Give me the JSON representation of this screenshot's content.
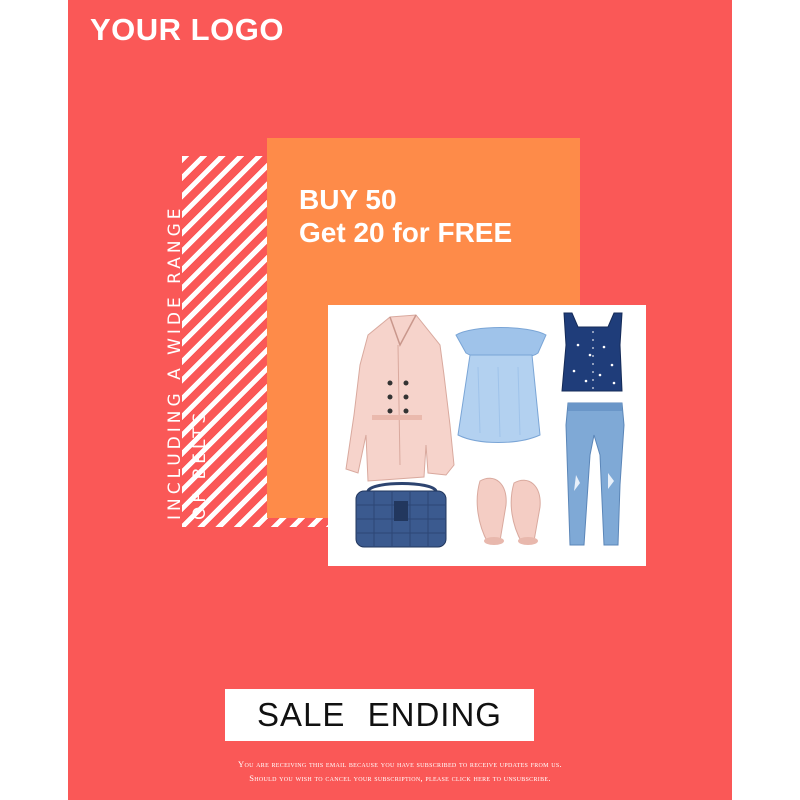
{
  "brand": {
    "logo_text": "YOUR LOGO"
  },
  "offer": {
    "line1": "BUY 50",
    "line2": "Get 20 for FREE"
  },
  "side_text": {
    "line1": "INCLUDING A WIDE RANGE",
    "line2": "OF BELTS"
  },
  "products": [
    "trench-coat",
    "off-shoulder-dress",
    "polka-dot-crop-top",
    "skinny-jeans",
    "quilted-handbag",
    "pink-sandals"
  ],
  "cta": {
    "label": "SALE ENDING"
  },
  "footer": {
    "line1": "You are receiving this email because you have subscribed to receive updates from us.",
    "line2": "Should you wish to cancel your subscription, please click here to unsubscribe."
  },
  "colors": {
    "background": "#fa5857",
    "accent": "#fe8b49",
    "text_light": "#ffffff",
    "text_dark": "#111111"
  }
}
